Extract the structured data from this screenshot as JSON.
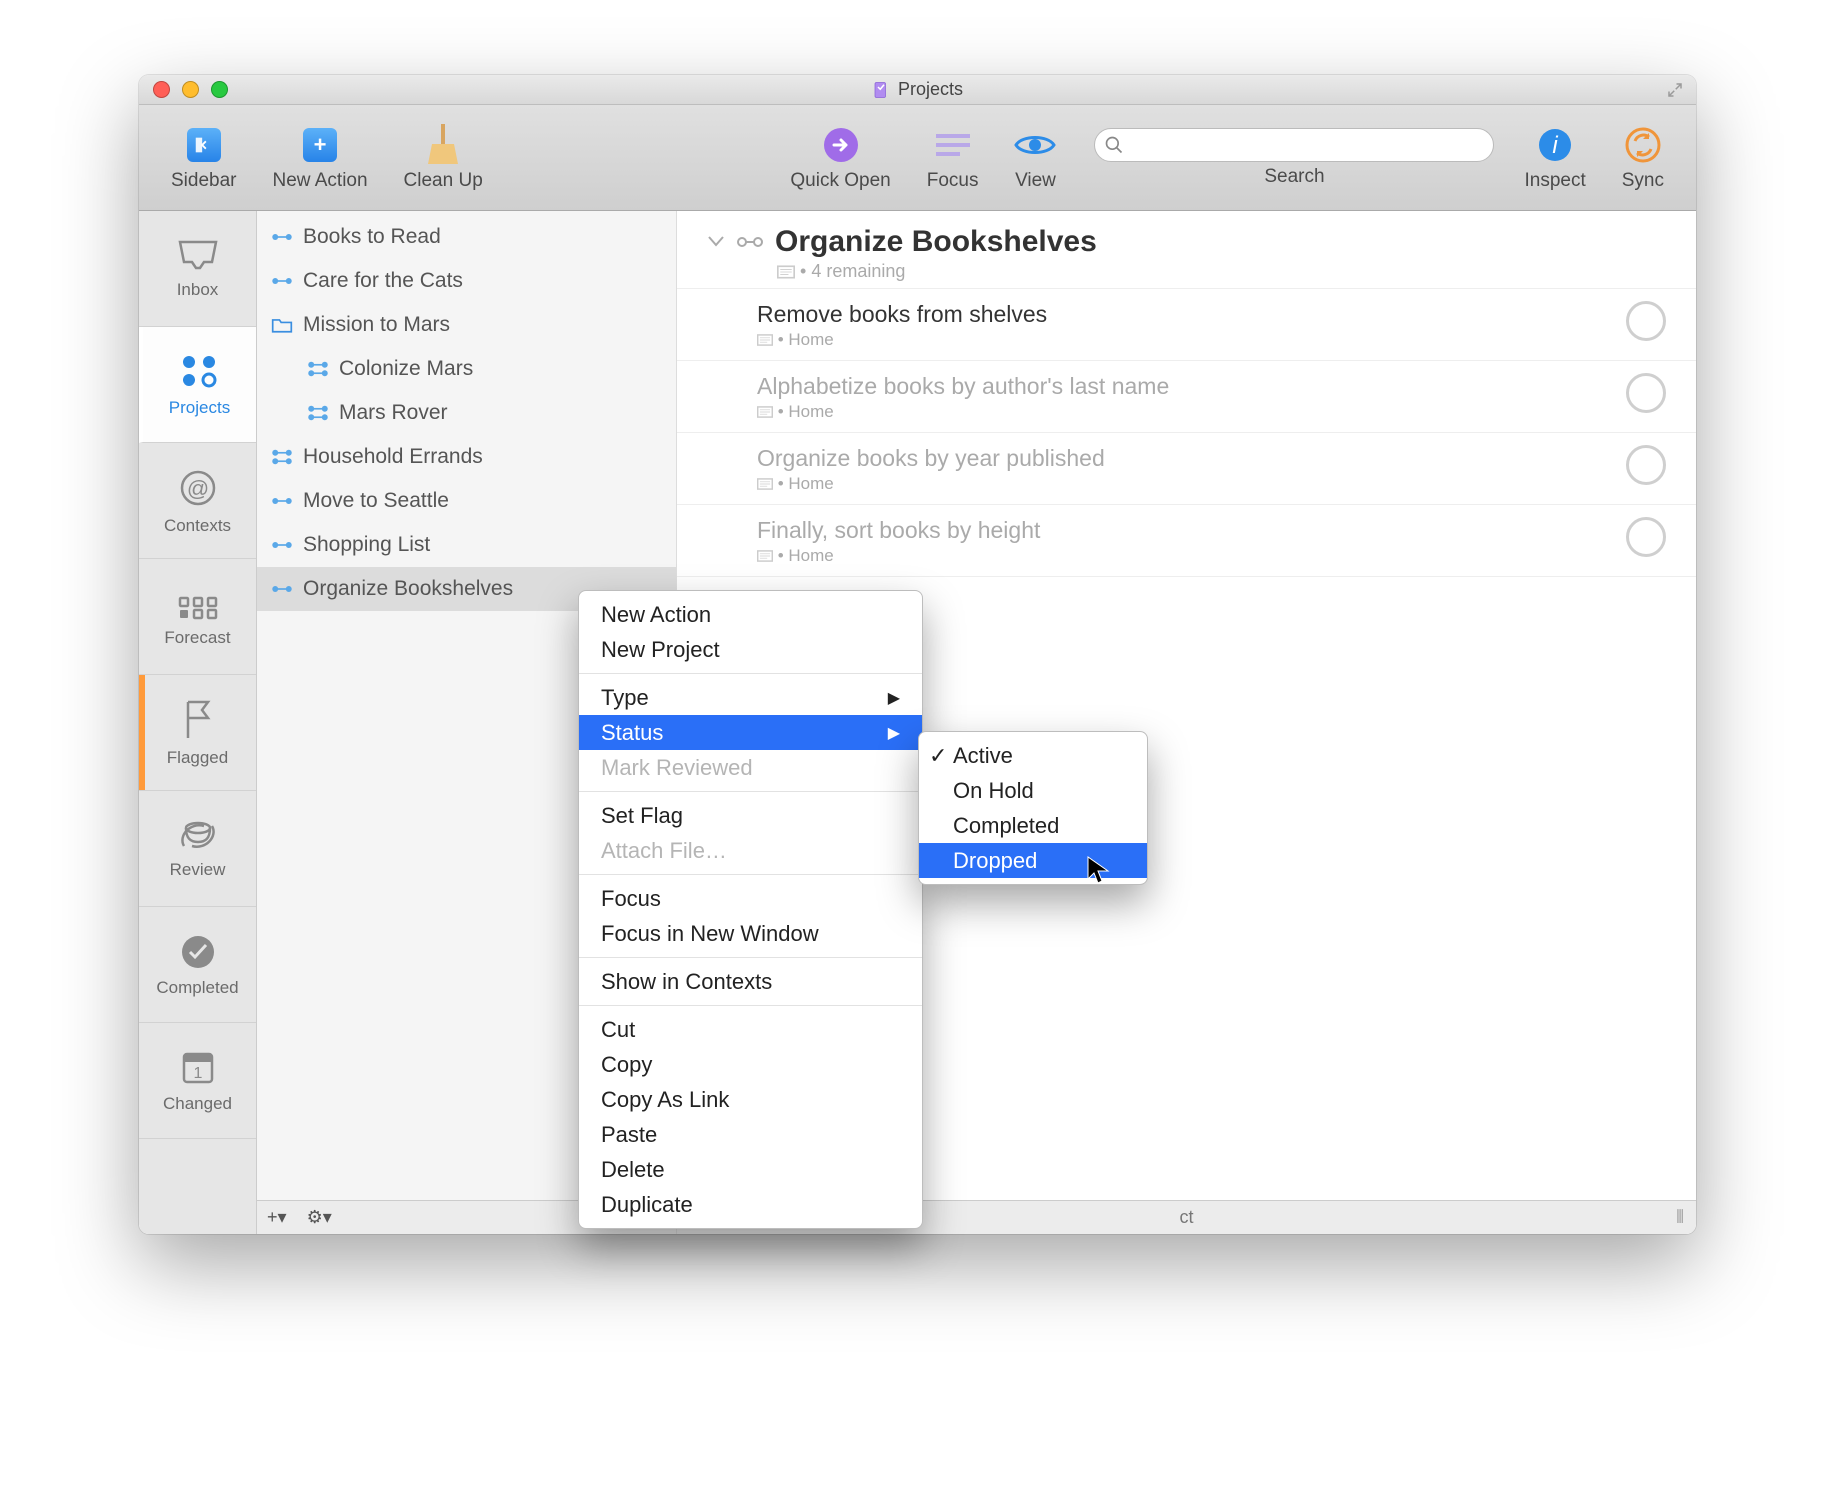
{
  "window_title": "Projects",
  "toolbar": {
    "sidebar": "Sidebar",
    "new_action": "New Action",
    "clean_up": "Clean Up",
    "quick_open": "Quick Open",
    "focus": "Focus",
    "view": "View",
    "search": "Search",
    "search_placeholder": "",
    "inspect": "Inspect",
    "sync": "Sync"
  },
  "perspectives": {
    "inbox": "Inbox",
    "projects": "Projects",
    "contexts": "Contexts",
    "forecast": "Forecast",
    "flagged": "Flagged",
    "review": "Review",
    "completed": "Completed",
    "changed": "Changed"
  },
  "project_list": [
    {
      "label": "Books to Read",
      "type": "seq",
      "indent": 0
    },
    {
      "label": "Care for the Cats",
      "type": "seq",
      "indent": 0
    },
    {
      "label": "Mission to Mars",
      "type": "folder",
      "indent": 0
    },
    {
      "label": "Colonize Mars",
      "type": "par",
      "indent": 1
    },
    {
      "label": "Mars Rover",
      "type": "par",
      "indent": 1
    },
    {
      "label": "Household Errands",
      "type": "par",
      "indent": 0
    },
    {
      "label": "Move to Seattle",
      "type": "seq",
      "indent": 0
    },
    {
      "label": "Shopping List",
      "type": "seq",
      "indent": 0
    },
    {
      "label": "Organize Bookshelves",
      "type": "seq",
      "indent": 0,
      "selected": true
    }
  ],
  "outline": {
    "title": "Organize Bookshelves",
    "subtitle": "4 remaining",
    "tasks": [
      {
        "title": "Remove books from shelves",
        "context": "Home",
        "future": false
      },
      {
        "title": "Alphabetize books by author's last name",
        "context": "Home",
        "future": true
      },
      {
        "title": "Organize books by year published",
        "context": "Home",
        "future": true
      },
      {
        "title": "Finally, sort books by height",
        "context": "Home",
        "future": true
      }
    ],
    "footer_hint": "ct"
  },
  "context_menu": {
    "groups": [
      [
        {
          "label": "New Action"
        },
        {
          "label": "New Project"
        }
      ],
      [
        {
          "label": "Type",
          "submenu": true
        },
        {
          "label": "Status",
          "submenu": true,
          "highlight": true
        },
        {
          "label": "Mark Reviewed",
          "disabled": true
        }
      ],
      [
        {
          "label": "Set Flag"
        },
        {
          "label": "Attach File…",
          "disabled": true
        }
      ],
      [
        {
          "label": "Focus"
        },
        {
          "label": "Focus in New Window"
        }
      ],
      [
        {
          "label": "Show in Contexts"
        }
      ],
      [
        {
          "label": "Cut"
        },
        {
          "label": "Copy"
        },
        {
          "label": "Copy As Link"
        },
        {
          "label": "Paste"
        },
        {
          "label": "Delete"
        },
        {
          "label": "Duplicate"
        }
      ]
    ]
  },
  "submenu": {
    "items": [
      {
        "label": "Active",
        "checked": true
      },
      {
        "label": "On Hold"
      },
      {
        "label": "Completed"
      },
      {
        "label": "Dropped",
        "highlight": true
      }
    ]
  },
  "footer_controls": {
    "add": "+",
    "gear": "⚙︎"
  }
}
